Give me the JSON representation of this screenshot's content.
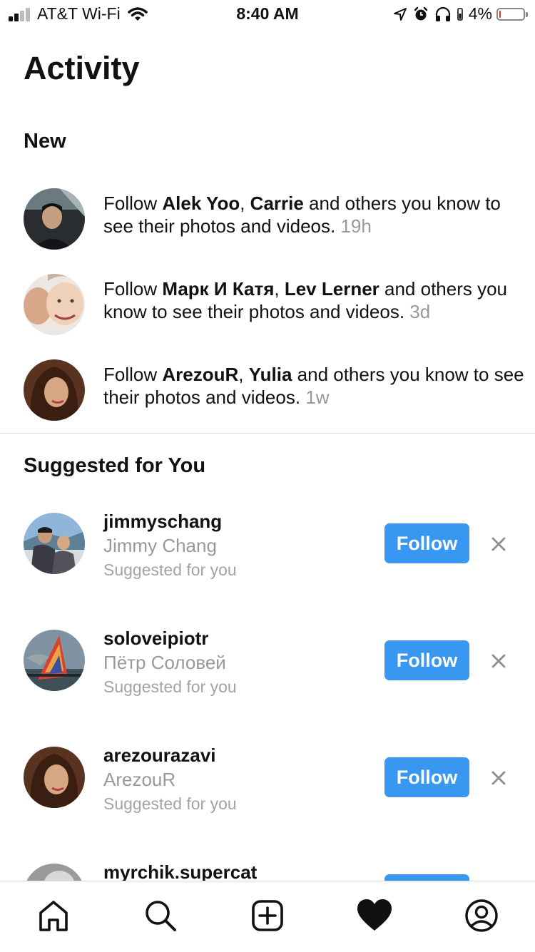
{
  "status_bar": {
    "carrier": "AT&T Wi-Fi",
    "time": "8:40 AM",
    "battery": "4%"
  },
  "page_title": "Activity",
  "sections": {
    "new": "New",
    "suggested": "Suggested for You"
  },
  "notifications": [
    {
      "prefix": "Follow ",
      "name1": "Alek Yoo",
      "sep": ", ",
      "name2": "Carrie",
      "rest": " and others you know to see their photos and videos.",
      "time": "19h"
    },
    {
      "prefix": "Follow ",
      "name1": "Марк И Катя",
      "sep": ", ",
      "name2": "Lev Lerner",
      "rest": " and others you know to see their photos and videos.",
      "time": "3d"
    },
    {
      "prefix": "Follow ",
      "name1": "ArezouR",
      "sep": ", ",
      "name2": "Yulia",
      "rest": " and others you know to see their photos and videos.",
      "time": "1w"
    }
  ],
  "suggestions": [
    {
      "username": "jimmyschang",
      "full_name": "Jimmy Chang",
      "note": "Suggested for you",
      "button": "Follow"
    },
    {
      "username": "soloveipiotr",
      "full_name": "Пётр Соловей",
      "note": "Suggested for you",
      "button": "Follow"
    },
    {
      "username": "arezourazavi",
      "full_name": "ArezouR",
      "note": "Suggested for you",
      "button": "Follow"
    },
    {
      "username": "myrchik.supercat"
    }
  ],
  "colors": {
    "accent": "#3897f0",
    "muted": "#999999",
    "divider": "#dbdbdb"
  },
  "tab_bar": [
    "home-icon",
    "search-icon",
    "new-post-icon",
    "heart-icon",
    "profile-icon"
  ]
}
